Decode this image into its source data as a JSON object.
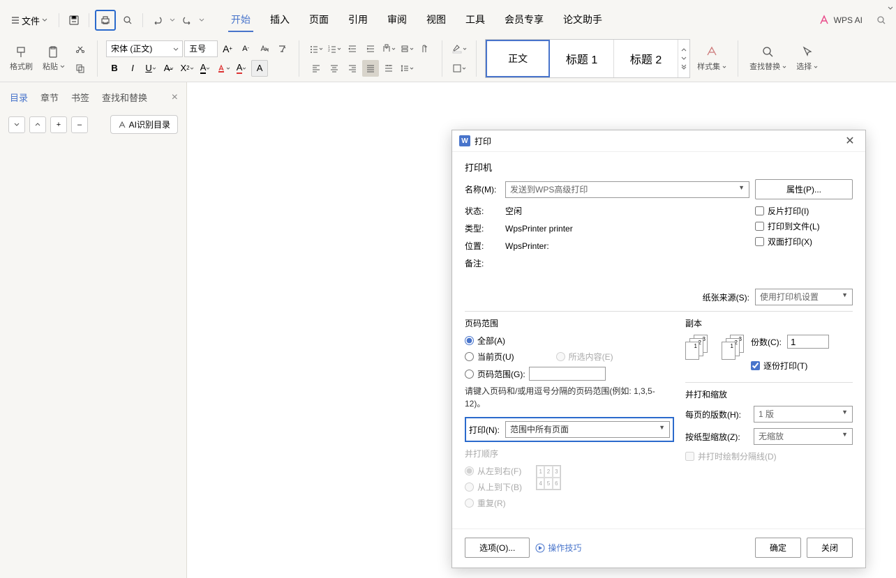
{
  "menu": {
    "file": "文件",
    "tabs": [
      "开始",
      "插入",
      "页面",
      "引用",
      "审阅",
      "视图",
      "工具",
      "会员专享",
      "论文助手"
    ],
    "wps_ai": "WPS AI"
  },
  "ribbon": {
    "format_painter": "格式刷",
    "paste": "粘贴",
    "font": "宋体 (正文)",
    "font_size": "五号",
    "styles": {
      "normal": "正文",
      "h1": "标题 1",
      "h2": "标题 2",
      "gallery_label": "样式集"
    },
    "findreplace": "查找替换",
    "select": "选择"
  },
  "left_panel": {
    "tabs": [
      "目录",
      "章节",
      "书签",
      "查找和替换"
    ],
    "ai_toc": "AI识别目录"
  },
  "dialog": {
    "title": "打印",
    "printer_section": "打印机",
    "name_label": "名称(M):",
    "name_value": "发送到WPS高级打印",
    "props_btn": "属性(P)...",
    "status_label": "状态:",
    "status_value": "空闲",
    "type_label": "类型:",
    "type_value": "WpsPrinter printer",
    "location_label": "位置:",
    "location_value": "WpsPrinter:",
    "remark_label": "备注:",
    "chk_mirror": "反片打印(I)",
    "chk_tofile": "打印到文件(L)",
    "chk_duplex": "双面打印(X)",
    "paper_source_label": "纸张来源(S):",
    "paper_source_value": "使用打印机设置",
    "page_range_section": "页码范围",
    "radio_all": "全部(A)",
    "radio_current": "当前页(U)",
    "radio_selection": "所选内容(E)",
    "radio_page_range": "页码范围(G):",
    "hint": "请键入页码和/或用逗号分隔的页码范围(例如: 1,3,5-12)。",
    "copies_section": "副本",
    "copies_label": "份数(C):",
    "copies_value": "1",
    "collate": "逐份打印(T)",
    "print_what_label": "打印(N):",
    "print_what_value": "范围中所有页面",
    "order_section": "并打顺序",
    "order_ltr": "从左到右(F)",
    "order_ttb": "从上到下(B)",
    "order_repeat": "重复(R)",
    "merge_section": "并打和缩放",
    "pages_per_sheet_label": "每页的版数(H):",
    "pages_per_sheet_value": "1 版",
    "scale_label": "按纸型缩放(Z):",
    "scale_value": "无缩放",
    "draw_separator": "并打时绘制分隔线(D)",
    "options_btn": "选项(O)...",
    "tips": "操作技巧",
    "ok": "确定",
    "cancel": "关闭"
  }
}
